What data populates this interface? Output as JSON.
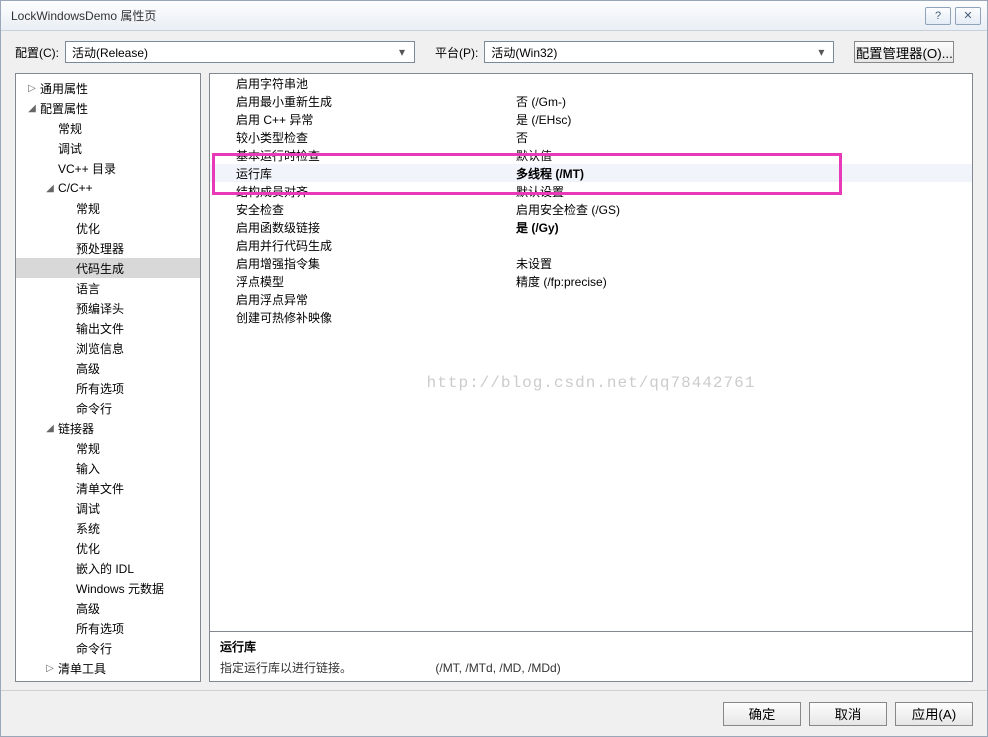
{
  "window": {
    "title": "LockWindowsDemo 属性页"
  },
  "toolbar": {
    "config_label": "配置(C):",
    "config_value": "活动(Release)",
    "platform_label": "平台(P):",
    "platform_value": "活动(Win32)",
    "manager_btn": "配置管理器(O)..."
  },
  "tree": [
    {
      "lvl": 0,
      "tw": "▷",
      "label": "通用属性"
    },
    {
      "lvl": 0,
      "tw": "◢",
      "label": "配置属性"
    },
    {
      "lvl": 1,
      "tw": "",
      "label": "常规"
    },
    {
      "lvl": 1,
      "tw": "",
      "label": "调试"
    },
    {
      "lvl": 1,
      "tw": "",
      "label": "VC++ 目录"
    },
    {
      "lvl": 1,
      "tw": "◢",
      "label": "C/C++"
    },
    {
      "lvl": 2,
      "tw": "",
      "label": "常规"
    },
    {
      "lvl": 2,
      "tw": "",
      "label": "优化"
    },
    {
      "lvl": 2,
      "tw": "",
      "label": "预处理器"
    },
    {
      "lvl": 2,
      "tw": "",
      "label": "代码生成",
      "sel": true
    },
    {
      "lvl": 2,
      "tw": "",
      "label": "语言"
    },
    {
      "lvl": 2,
      "tw": "",
      "label": "预编译头"
    },
    {
      "lvl": 2,
      "tw": "",
      "label": "输出文件"
    },
    {
      "lvl": 2,
      "tw": "",
      "label": "浏览信息"
    },
    {
      "lvl": 2,
      "tw": "",
      "label": "高级"
    },
    {
      "lvl": 2,
      "tw": "",
      "label": "所有选项"
    },
    {
      "lvl": 2,
      "tw": "",
      "label": "命令行"
    },
    {
      "lvl": 1,
      "tw": "◢",
      "label": "链接器"
    },
    {
      "lvl": 2,
      "tw": "",
      "label": "常规"
    },
    {
      "lvl": 2,
      "tw": "",
      "label": "输入"
    },
    {
      "lvl": 2,
      "tw": "",
      "label": "清单文件"
    },
    {
      "lvl": 2,
      "tw": "",
      "label": "调试"
    },
    {
      "lvl": 2,
      "tw": "",
      "label": "系统"
    },
    {
      "lvl": 2,
      "tw": "",
      "label": "优化"
    },
    {
      "lvl": 2,
      "tw": "",
      "label": "嵌入的 IDL"
    },
    {
      "lvl": 2,
      "tw": "",
      "label": "Windows 元数据"
    },
    {
      "lvl": 2,
      "tw": "",
      "label": "高级"
    },
    {
      "lvl": 2,
      "tw": "",
      "label": "所有选项"
    },
    {
      "lvl": 2,
      "tw": "",
      "label": "命令行"
    },
    {
      "lvl": 1,
      "tw": "▷",
      "label": "清单工具"
    }
  ],
  "grid": [
    {
      "name": "启用字符串池",
      "value": ""
    },
    {
      "name": "启用最小重新生成",
      "value": "否 (/Gm-)"
    },
    {
      "name": "启用 C++ 异常",
      "value": "是 (/EHsc)"
    },
    {
      "name": "较小类型检查",
      "value": "否"
    },
    {
      "name": "基本运行时检查",
      "value": "默认值"
    },
    {
      "name": "运行库",
      "value": "多线程 (/MT)",
      "bold": true,
      "sel": true
    },
    {
      "name": "结构成员对齐",
      "value": "默认设置"
    },
    {
      "name": "安全检查",
      "value": "启用安全检查 (/GS)"
    },
    {
      "name": "启用函数级链接",
      "value": "是 (/Gy)",
      "bold": true
    },
    {
      "name": "启用并行代码生成",
      "value": ""
    },
    {
      "name": "启用增强指令集",
      "value": "未设置"
    },
    {
      "name": "浮点模型",
      "value": "精度 (/fp:precise)"
    },
    {
      "name": "启用浮点异常",
      "value": ""
    },
    {
      "name": "创建可热修补映像",
      "value": ""
    }
  ],
  "description": {
    "title": "运行库",
    "text": "指定运行库以进行链接。",
    "options": "(/MT, /MTd, /MD, /MDd)"
  },
  "footer": {
    "ok": "确定",
    "cancel": "取消",
    "apply": "应用(A)"
  },
  "watermark": "http://blog.csdn.net/qq78442761"
}
